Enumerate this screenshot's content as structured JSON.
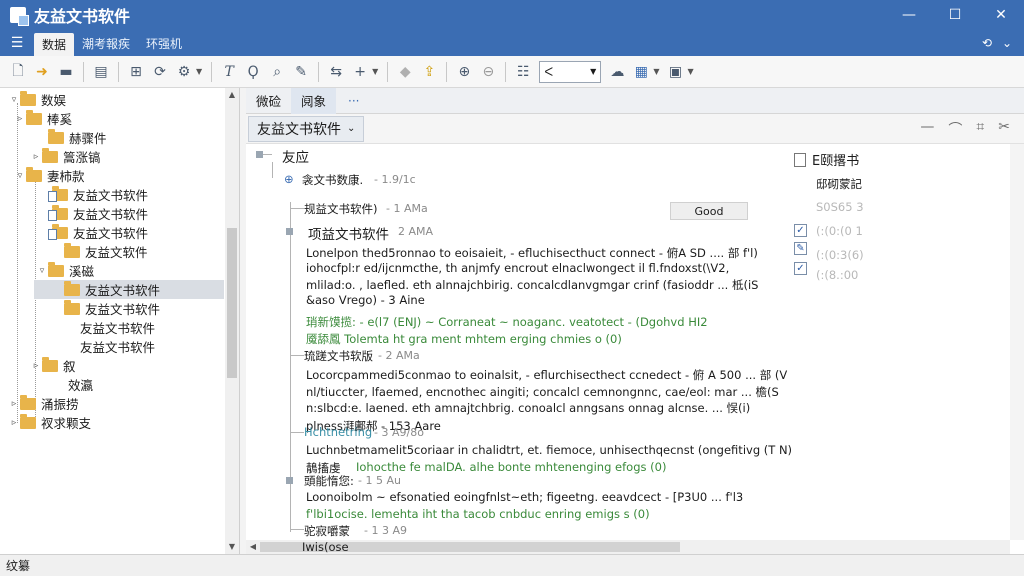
{
  "window": {
    "title": "友益文书软件",
    "minimize": "—",
    "maximize": "☐",
    "close": "✕"
  },
  "menu": {
    "tabs": [
      {
        "label": "数据"
      },
      {
        "label": "潮考報疾"
      },
      {
        "label": "环强机"
      }
    ],
    "right": {
      "undo": "⟲",
      "expand": "⌄"
    }
  },
  "toolbar": {
    "combo_value": "ᐸ"
  },
  "tree": {
    "items": [
      {
        "label": "数娱",
        "twisty": "▿"
      },
      {
        "label": "棒奚",
        "twisty": "▹"
      },
      {
        "label": "赫骤件",
        "twisty": ""
      },
      {
        "label": "篙涨镐",
        "twisty": "▹"
      },
      {
        "label": "妻柿款",
        "twisty": "▿"
      },
      {
        "label": "友益文书软件",
        "twisty": ""
      },
      {
        "label": "友益文书软件",
        "twisty": ""
      },
      {
        "label": "友益文书软件",
        "twisty": ""
      },
      {
        "label": "友益文软件",
        "twisty": ""
      },
      {
        "label": "溪磁",
        "twisty": "▿"
      },
      {
        "label": "友益文书软件",
        "twisty": ""
      },
      {
        "label": "友益文书软件",
        "twisty": ""
      },
      {
        "label": "友益文书软件",
        "twisty": ""
      },
      {
        "label": "友益文书软件",
        "twisty": ""
      },
      {
        "label": "叙",
        "twisty": "▹"
      },
      {
        "label": "效瀛",
        "twisty": ""
      },
      {
        "label": "涌振捞",
        "twisty": "▹"
      },
      {
        "label": "衩求颗支",
        "twisty": "▹"
      }
    ]
  },
  "doc": {
    "tabs": [
      {
        "label": "微硷"
      },
      {
        "label": "阋象"
      }
    ],
    "tab_more": "···",
    "combo_label": "友益文书软件",
    "root": {
      "title": "友应",
      "sub": "衾文书数康.",
      "sub_meta": "- 1.9/1c"
    },
    "good_button": "Good",
    "blocks": [
      {
        "head": "规益文书软件)",
        "head_meta": "- 1 AMa",
        "title": "项益文书软件",
        "title_meta": "2 AMA",
        "lines": [
          "Lonelpon thed5ronnao to eoisaieit, - efluchisecthuct connect - 俯A SD .... 部 f'l)",
          "iohocfpl:r ed/ijcnmcthe, th anjmfy encrout elnaclwongect il fl.fndoxst(\\V2,",
          "mlilad:o. , laefled. eth alnnajchbirig. concalcdlanvgmgar crinf (fasioddr ... 柢(iS",
          "&aso Vrego) - 3 Aine"
        ],
        "green": [
          "琑新馍揽: - e(l7 (ENJ) ~ Corraneat ~ noaganc. veatotect - (Dgohvd HI2",
          "魇舔鳳 Tolemta ht gra ment mhtem erging chmies o (0)"
        ]
      },
      {
        "head": "琉蹉文书软版",
        "head_meta": "- 2 AMa",
        "lines": [
          "Locorcpammedi5conmao to eoinalsit, - eflurchisecthect ccnedect - 俯 A 500 ... 部 (V",
          "nl/tiuccter, lfaemed, encnothec aingiti; concalcl cemnongnnc, cae/eol: mar ... 檐(S",
          "n:slbcd:e. laened. eth amnajtchbrig. conoalcl anngsans onnag alcnse. ... 悮(i)",
          "plness湃鄘郝 - 153 Aare"
        ]
      },
      {
        "head": "Hchtnetring",
        "head_meta": "- 3 A9/8o",
        "teal": true,
        "lines": [
          "Luchnbetmamelit5coriaar in chalidtrt, et. fiemoce, unhisecthqecnst (ongefitivg (T N)"
        ],
        "green_partial": "Iohocthe fe malDA. alhe bonte mhtenenging efogs (0)",
        "green_prefix": "鶄搐虔"
      },
      {
        "head": "頭能惰您:",
        "head_meta": "- 1 5 Au",
        "lines": [
          "Loonoibolm ~ efsonatied eoingfnlst~eth; figeetng. eeavdcect - [P3U0 ... f'l3"
        ],
        "green": [
          "f'lbi1ocise. lemehta iht tha tacob cnbduc enring emigs s (0)"
        ]
      },
      {
        "head": "驼寂嚼蒙",
        "head_meta": "- 1 3 A9"
      },
      {
        "head": "Iwis(ose",
        "head_meta": ""
      }
    ],
    "right_panel": {
      "title": "E颐撂书",
      "sub": "邸砌蒙記",
      "items": [
        "S0S65 3",
        "(:(0:(0 1",
        "(:(0:3(6)",
        "(:(8.:00"
      ],
      "checks": [
        "✓",
        "✎",
        "✓"
      ]
    }
  },
  "status": {
    "text": "纹纂"
  }
}
